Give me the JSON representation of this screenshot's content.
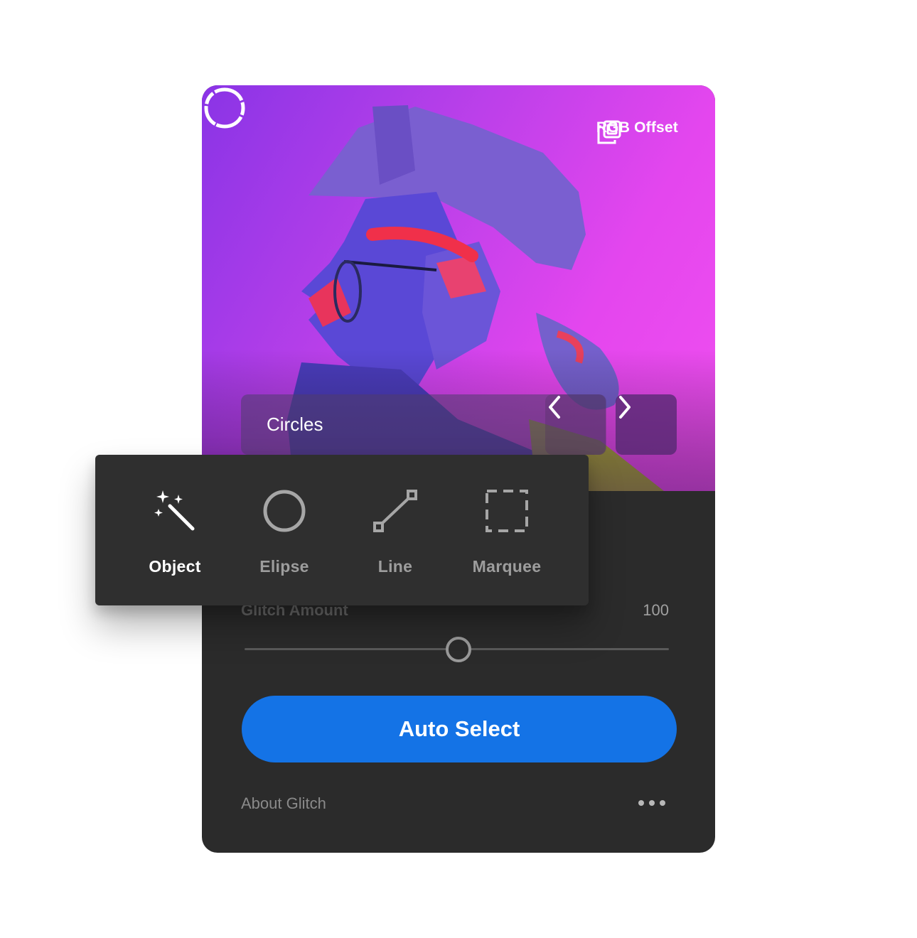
{
  "header": {
    "rgb_offset_label": "RGB Offset",
    "logo_icon": "rough-circle-icon",
    "rgb_offset_icon": "layers-copy-icon"
  },
  "preset": {
    "label": "Circles",
    "prev_icon": "chevron-left-icon",
    "next_icon": "chevron-right-icon"
  },
  "tools": [
    {
      "label": "Object",
      "icon": "magic-wand-icon",
      "active": true
    },
    {
      "label": "Elipse",
      "icon": "ellipse-icon",
      "active": false
    },
    {
      "label": "Line",
      "icon": "line-icon",
      "active": false
    },
    {
      "label": "Marquee",
      "icon": "marquee-icon",
      "active": false
    }
  ],
  "glitch": {
    "label": "Glitch Amount",
    "value": "100",
    "slider_fraction": 0.5
  },
  "actions": {
    "auto_select_label": "Auto Select",
    "about_label": "About Glitch",
    "more_icon": "more-horizontal-icon"
  },
  "colors": {
    "accent_blue": "#1473e6",
    "panel_bg": "#2b2b2b",
    "popover_bg": "#2f2f2f"
  }
}
